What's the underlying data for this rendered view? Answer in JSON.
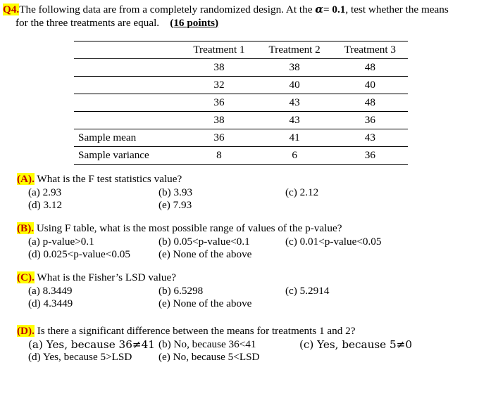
{
  "header": {
    "question_label": "Q4.",
    "line1_part1": "The following data are from a completely randomized design. At the ",
    "alpha_symbol": "α",
    "alpha_value": "= 0.1",
    "line1_part2": ", test whether the means",
    "line2_part1": "for the three treatments are equal.",
    "points": "(16 points)"
  },
  "table": {
    "columns": [
      "Treatment 1",
      "Treatment 2",
      "Treatment 3"
    ],
    "data_rows": [
      [
        "38",
        "38",
        "48"
      ],
      [
        "32",
        "40",
        "40"
      ],
      [
        "36",
        "43",
        "48"
      ],
      [
        "38",
        "43",
        "36"
      ]
    ],
    "summary_rows": [
      {
        "label": "Sample mean",
        "values": [
          "36",
          "41",
          "43"
        ]
      },
      {
        "label": "Sample variance",
        "values": [
          "8",
          "6",
          "36"
        ]
      }
    ]
  },
  "questions": [
    {
      "id": "a",
      "label": "(A).",
      "prompt": "What is the F test statistics value?",
      "options": {
        "a": "(a) 2.93",
        "b": "(b) 3.93",
        "c": "(c) 2.12",
        "d": "(d) 3.12",
        "e": "(e) 7.93"
      }
    },
    {
      "id": "b",
      "label": "(B).",
      "prompt": "Using F table, what is the most possible range of values of the p-value?",
      "options": {
        "a": "(a) p-value>0.1",
        "b": "(b) 0.05<p-value<0.1",
        "c": "(c) 0.01<p-value<0.05",
        "d": "(d) 0.025<p-value<0.05",
        "e": "(e) None of the above"
      }
    },
    {
      "id": "c",
      "label": "(C).",
      "prompt": "What is the Fisher’s LSD value?",
      "options": {
        "a": "(a) 8.3449",
        "b": "(b) 6.5298",
        "c": "(c) 5.2914",
        "d": "(d) 4.3449",
        "e": "(e) None of the above"
      }
    },
    {
      "id": "d",
      "label": "(D).",
      "prompt": "Is there a significant difference between the means for treatments 1 and 2?",
      "options": {
        "a": "(a) Yes, because 36≠41",
        "b": "(b) No, because 36<41",
        "c": "(c) Yes, because 5≠0",
        "d": "(d) Yes, because 5>LSD",
        "e": "(e) No, because 5<LSD"
      }
    }
  ],
  "colors": {
    "highlight": "#ffff00",
    "label_text": "#c00000",
    "body_text": "#000000"
  }
}
